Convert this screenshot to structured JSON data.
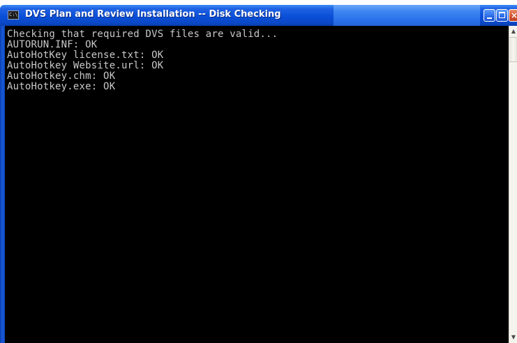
{
  "window": {
    "title": "DVS Plan and Review Installation -- Disk Checking",
    "icon": "cmd-icon",
    "icon_text": "C:\\",
    "buttons": {
      "minimize_icon": "minimize-icon",
      "maximize_icon": "maximize-icon",
      "close_icon": "close-icon",
      "close_glyph": "×"
    }
  },
  "console": {
    "lines": [
      "Checking that required DVS files are valid...",
      "AUTORUN.INF: OK",
      "AutoHotKey license.txt: OK",
      "AutoHotkey Website.url: OK",
      "AutoHotkey.chm: OK",
      "AutoHotkey.exe: OK"
    ]
  },
  "scrollbar": {
    "up_glyph": "▲",
    "down_glyph": "▼"
  },
  "colors": {
    "titlebar": "#0a4fd8",
    "console_bg": "#000000",
    "console_text": "#c8c8c8"
  }
}
